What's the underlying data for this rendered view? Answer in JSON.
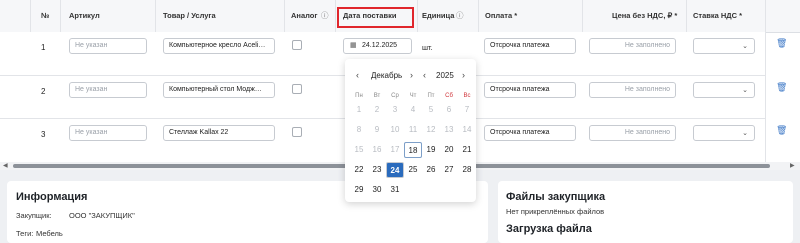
{
  "table": {
    "headers": {
      "num": "№",
      "article": "Артикул",
      "product": "Товар / Услуга",
      "analog": "Аналог",
      "delivery_date": "Дата поставки",
      "unit": "Единица",
      "payment": "Оплата *",
      "price": "Цена без НДС, ₽ *",
      "vat": "Ставка НДС *"
    },
    "rows": [
      {
        "num": "1",
        "article_placeholder": "Не указан",
        "product": "Компьютерное кресло Aceli…",
        "date": "24.12.2025",
        "unit": "шт.",
        "payment": "Отсрочка платежа",
        "price_placeholder": "Не заполнено"
      },
      {
        "num": "2",
        "article_placeholder": "Не указан",
        "product": "Компьютерный стол Модж…",
        "payment": "Отсрочка платежа",
        "price_placeholder": "Не заполнено"
      },
      {
        "num": "3",
        "article_placeholder": "Не указан",
        "product": "Стеллаж Kallax 22",
        "payment": "Отсрочка платежа",
        "price_placeholder": "Не заполнено"
      }
    ]
  },
  "calendar": {
    "month": "Декабрь",
    "year": "2025",
    "weekdays": [
      "Пн",
      "Вт",
      "Ср",
      "Чт",
      "Пт",
      "Сб",
      "Вс"
    ],
    "days": [
      [
        "1",
        "2",
        "3",
        "4",
        "5",
        "6",
        "7"
      ],
      [
        "8",
        "9",
        "10",
        "11",
        "12",
        "13",
        "14"
      ],
      [
        "15",
        "16",
        "17",
        "18",
        "19",
        "20",
        "21"
      ],
      [
        "22",
        "23",
        "24",
        "25",
        "26",
        "27",
        "28"
      ],
      [
        "29",
        "30",
        "31",
        "",
        "",
        "",
        ""
      ]
    ],
    "selected_day": "24",
    "today_day": "18"
  },
  "info_panel": {
    "title": "Информация",
    "customer_label": "Закупщик:",
    "customer_value": "ООО \"ЗАКУПЩИК\"",
    "tags_label": "Теги:",
    "tags_value": "Мебель"
  },
  "files_panel": {
    "title": "Файлы закупщика",
    "subtitle": "Нет прикреплённых файлов",
    "upload_title": "Загрузка файла"
  },
  "colors": {
    "accent": "#2a6bbd",
    "highlight_border": "#e0262c",
    "weekend": "#d0343a"
  },
  "icons": {
    "info": "info-circle-icon",
    "calendar": "calendar-icon",
    "trash": "trash-icon",
    "chevron": "chevron-down-icon"
  }
}
